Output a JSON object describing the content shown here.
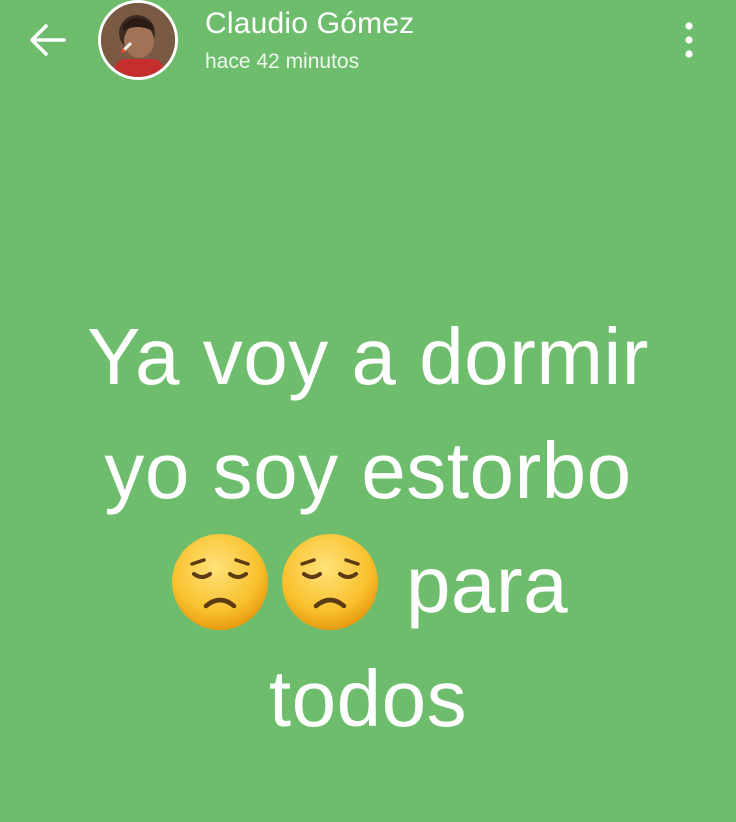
{
  "header": {
    "back_icon": "arrow-left-icon",
    "user_name": "Claudio Gómez",
    "timestamp": "hace 42 minutos",
    "menu_icon": "more-vertical-icon"
  },
  "status": {
    "line1": "Ya voy a dormir",
    "line2": "yo soy estorbo",
    "emoji_icon": "pensive-face-icon",
    "emoji_count": 2,
    "line3_text": "para",
    "line4": "todos"
  },
  "colors": {
    "background": "#6ebd6d",
    "text": "#ffffff"
  }
}
